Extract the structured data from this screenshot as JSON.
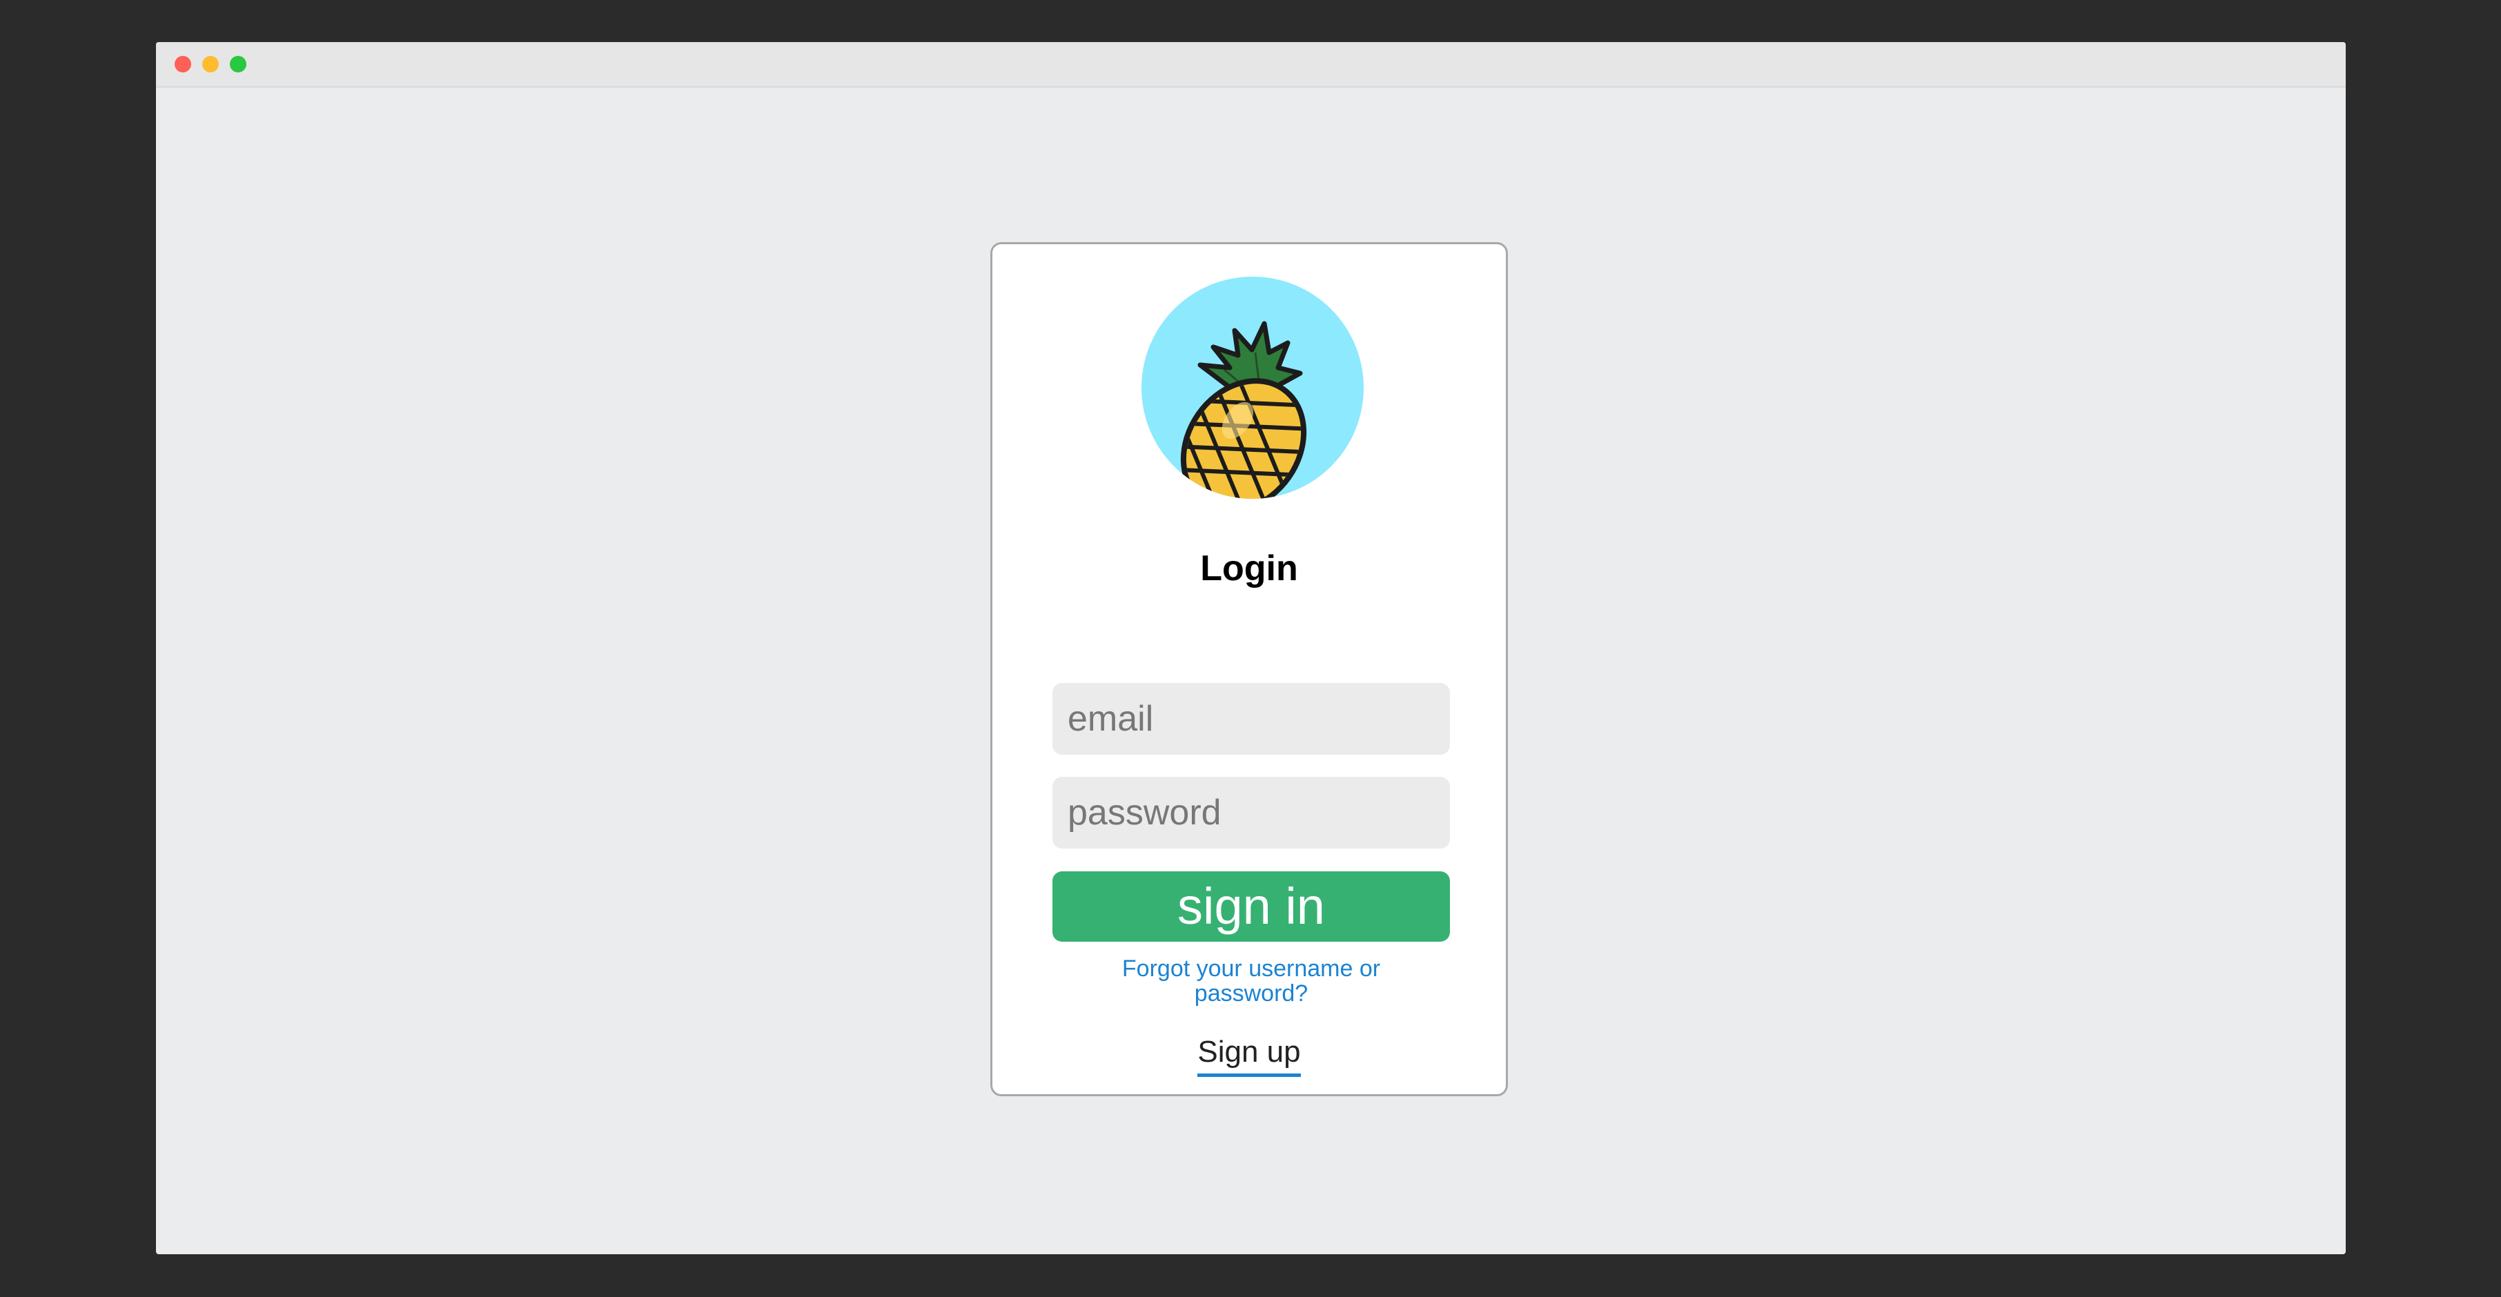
{
  "window": {
    "controls": [
      "close",
      "minimize",
      "maximize"
    ]
  },
  "login": {
    "logo_icon": "pineapple-icon",
    "title": "Login",
    "email_placeholder": "email",
    "password_placeholder": "password",
    "signin_label": "sign in",
    "forgot_link": "Forgot your username or password?",
    "signup_link": "Sign up"
  },
  "colors": {
    "accent_green": "#36b172",
    "link_blue": "#1b83d3",
    "logo_bg": "#8de9fd"
  }
}
